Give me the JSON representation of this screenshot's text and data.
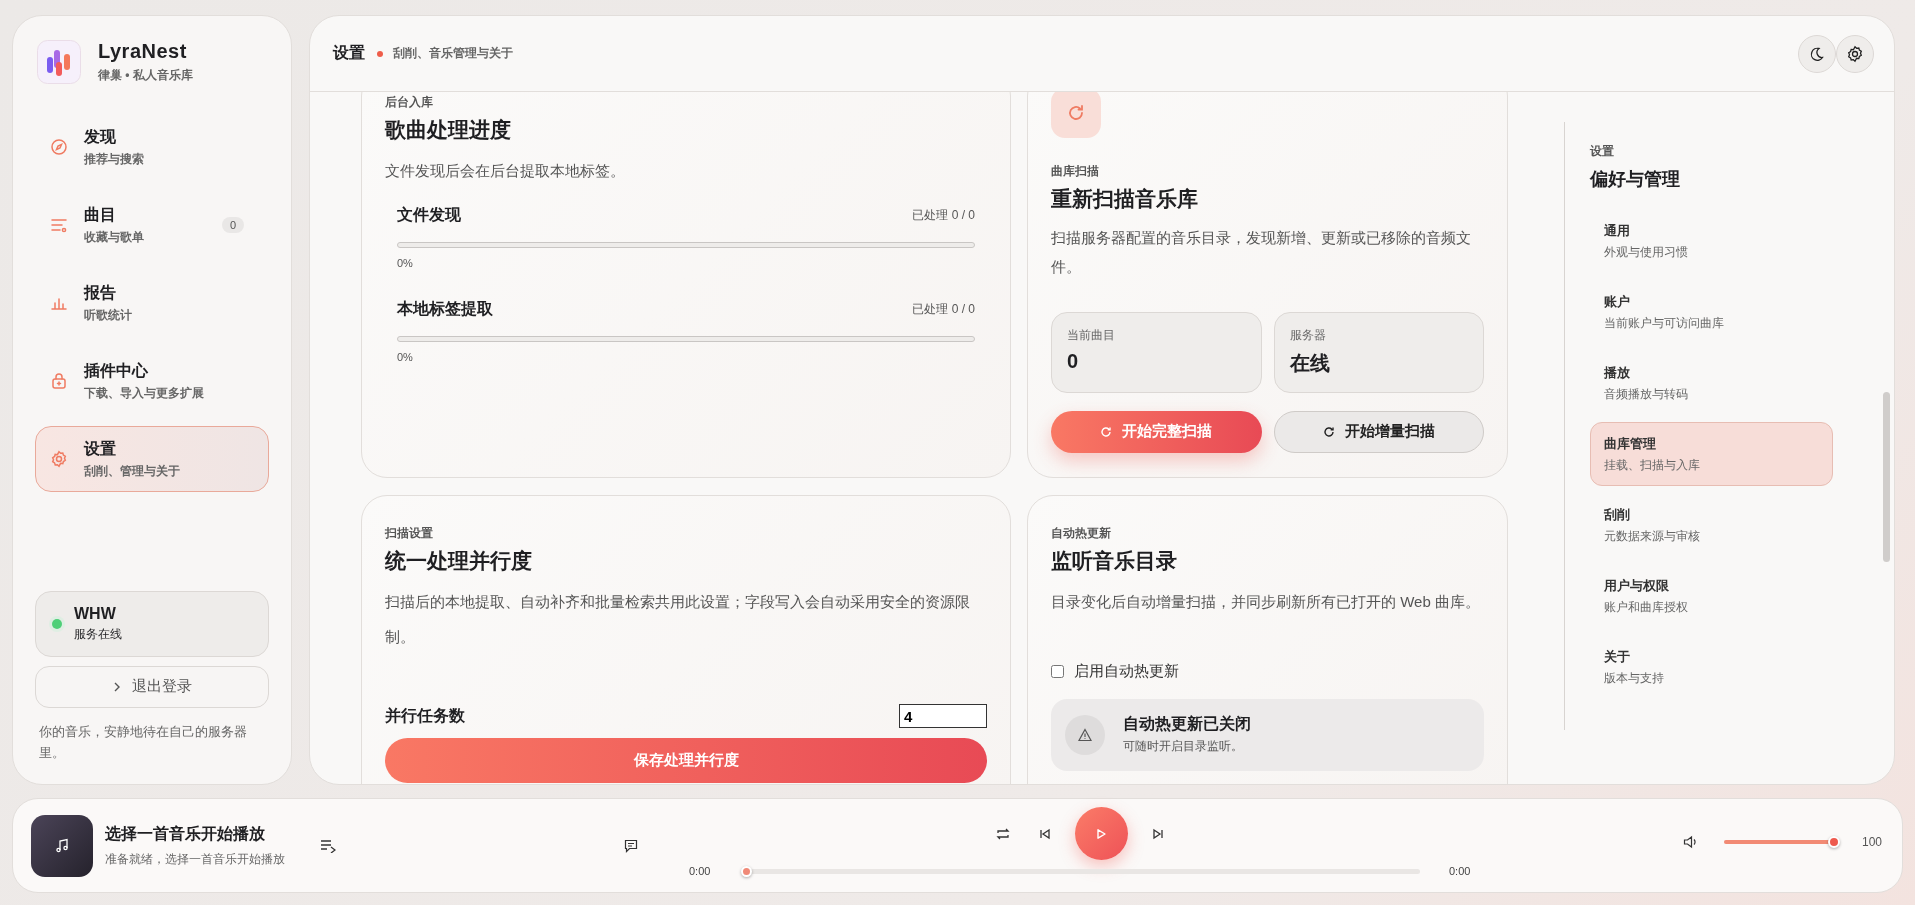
{
  "app": {
    "name": "LyraNest",
    "subtitle": "律巢 • 私人音乐库"
  },
  "nav": [
    {
      "kind": "compass",
      "title": "发现",
      "subtitle": "推荐与搜索",
      "selected": false
    },
    {
      "kind": "list",
      "title": "曲目",
      "subtitle": "收藏与歌单",
      "selected": false,
      "badge": "0"
    },
    {
      "kind": "chart",
      "title": "报告",
      "subtitle": "听歌统计",
      "selected": false
    },
    {
      "kind": "plugin",
      "title": "插件中心",
      "subtitle": "下载、导入与更多扩展",
      "selected": false
    },
    {
      "kind": "gear",
      "title": "设置",
      "subtitle": "刮削、管理与关于",
      "selected": true
    }
  ],
  "account": {
    "name": "WHW",
    "status": "服务在线",
    "online": true
  },
  "logout": "退出登录",
  "footer_note": "你的音乐，安静地待在自己的服务器里。",
  "header": {
    "title": "设置",
    "subtitle": "刮削、音乐管理与关于"
  },
  "processing": {
    "label": "后台入库",
    "title": "歌曲处理进度",
    "description": "文件发现后会在后台提取本地标签。",
    "tasks": [
      {
        "name": "文件发现",
        "count": "已处理 0 / 0",
        "level": 0,
        "percent": "0%"
      },
      {
        "name": "本地标签提取",
        "count": "已处理 0 / 0",
        "level": 0,
        "percent": "0%"
      }
    ]
  },
  "scan": {
    "label": "曲库扫描",
    "title": "重新扫描音乐库",
    "description": "扫描服务器配置的音乐目录，发现新增、更新或已移除的音频文件。",
    "stats": [
      {
        "label": "当前曲目",
        "value": "0"
      },
      {
        "label": "服务器",
        "value": "在线"
      }
    ],
    "buttons": [
      {
        "label": "开始完整扫描",
        "kind": "primary"
      },
      {
        "label": "开始增量扫描",
        "kind": "secondary"
      }
    ]
  },
  "concurrency": {
    "label": "扫描设置",
    "title": "统一处理并行度",
    "description": "扫描后的本地提取、自动补齐和批量检索共用此设置；字段写入会自动采用安全的资源限制。",
    "field_label": "并行任务数",
    "value": "4",
    "button": "保存处理并行度"
  },
  "watch": {
    "label": "自动热更新",
    "title": "监听音乐目录",
    "description": "目录变化后自动增量扫描，并同步刷新所有已打开的 Web 曲库。",
    "checkbox": {
      "label": "启用自动热更新",
      "checked": false
    },
    "notice": {
      "title": "自动热更新已关闭",
      "text": "可随时开启目录监听。"
    }
  },
  "settings_nav": {
    "label": "设置",
    "title": "偏好与管理",
    "items": [
      {
        "title": "通用",
        "subtitle": "外观与使用习惯",
        "selected": false
      },
      {
        "title": "账户",
        "subtitle": "当前账户与可访问曲库",
        "selected": false
      },
      {
        "title": "播放",
        "subtitle": "音频播放与转码",
        "selected": false
      },
      {
        "title": "曲库管理",
        "subtitle": "挂载、扫描与入库",
        "selected": true
      },
      {
        "title": "刮削",
        "subtitle": "元数据来源与审核",
        "selected": false
      },
      {
        "title": "用户与权限",
        "subtitle": "账户和曲库授权",
        "selected": false
      },
      {
        "title": "关于",
        "subtitle": "版本与支持",
        "selected": false
      }
    ]
  },
  "player": {
    "title": "选择一首音乐开始播放",
    "subtitle": "准备就绪，选择一首音乐开始播放",
    "playing": false,
    "elapsed": "0:00",
    "duration": "0:00",
    "progress": {
      "level": 0
    },
    "volume": {
      "level": 1
    },
    "volume_reading": "100"
  }
}
